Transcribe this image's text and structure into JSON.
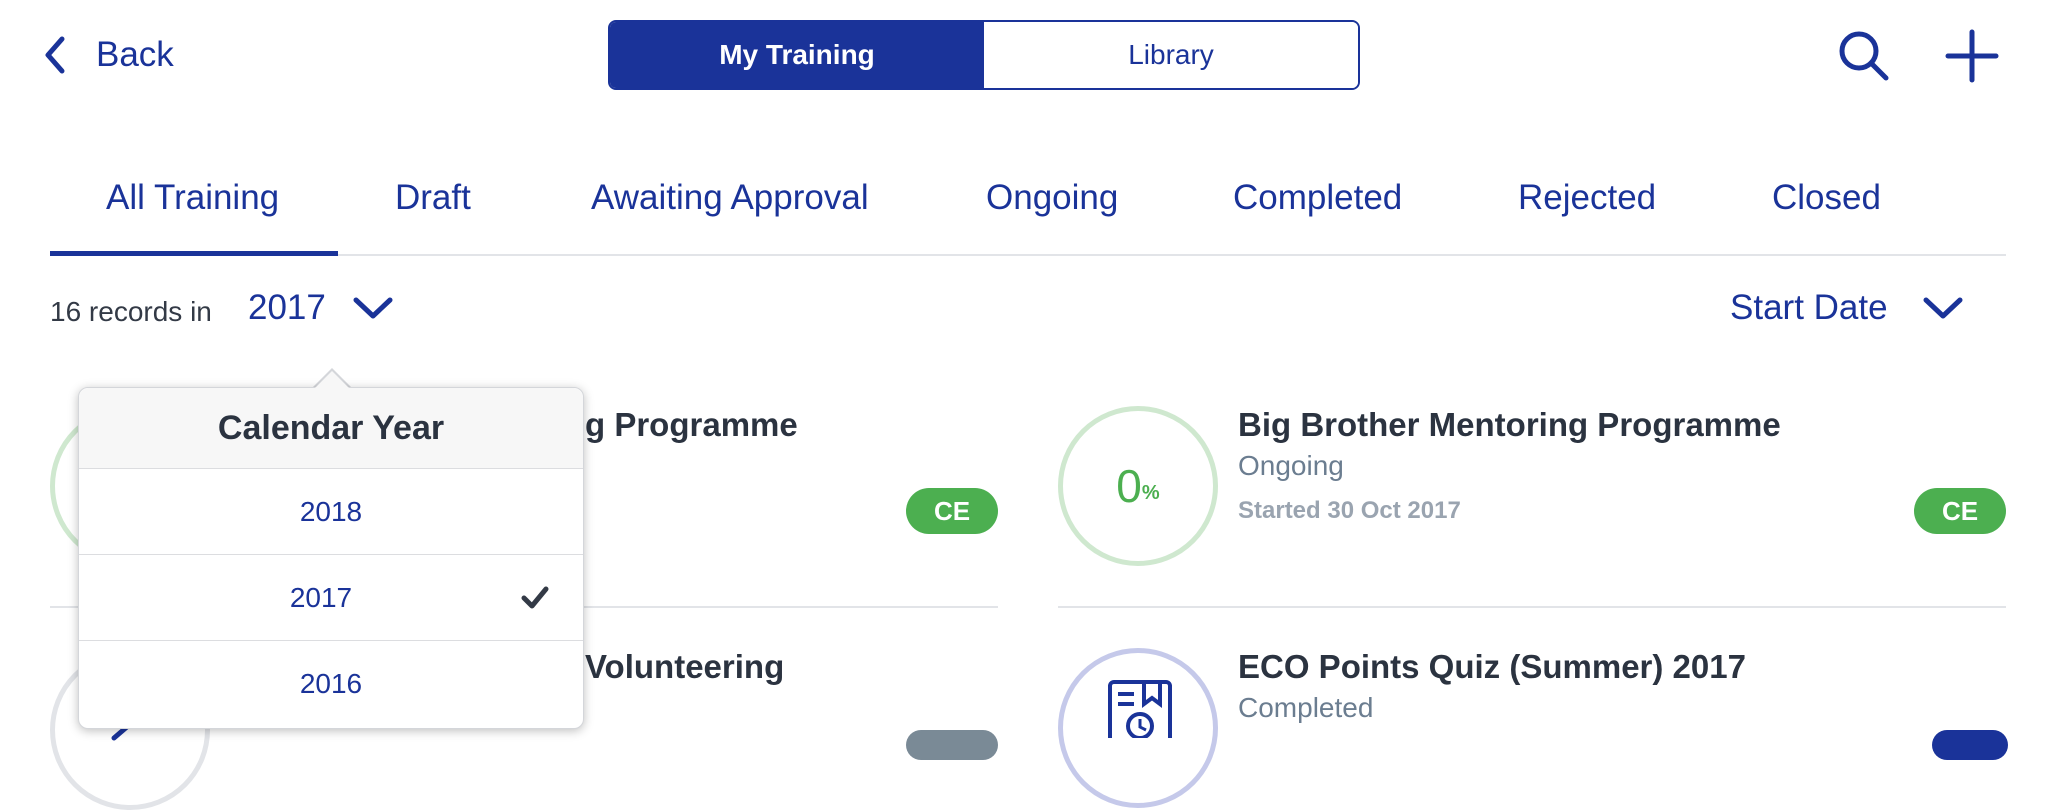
{
  "header": {
    "back_label": "Back",
    "segments": [
      {
        "label": "My Training",
        "active": true
      },
      {
        "label": "Library",
        "active": false
      }
    ],
    "icons": [
      "search-icon",
      "plus-icon"
    ]
  },
  "tabs": [
    {
      "label": "All Training",
      "active": true
    },
    {
      "label": "Draft"
    },
    {
      "label": "Awaiting Approval"
    },
    {
      "label": "Ongoing"
    },
    {
      "label": "Completed"
    },
    {
      "label": "Rejected"
    },
    {
      "label": "Closed"
    }
  ],
  "filter": {
    "records_text": "16 records in",
    "year": "2017",
    "sort_label": "Start Date"
  },
  "cards": [
    {
      "title_visible": "g Programme",
      "badge": "CE",
      "badge_color": "#4caf50"
    },
    {
      "title": "Big Brother Mentoring Programme",
      "status": "Ongoing",
      "date": "Started 30 Oct 2017",
      "progress_value": "0",
      "progress_unit": "%",
      "badge": "CE",
      "badge_color": "#4caf50"
    },
    {
      "title_visible": "Volunteering"
    },
    {
      "title": "ECO Points Quiz (Summer) 2017",
      "status": "Completed",
      "icon": "quiz-clock-icon"
    }
  ],
  "popover": {
    "title": "Calendar Year",
    "options": [
      {
        "label": "2018"
      },
      {
        "label": "2017",
        "selected": true
      },
      {
        "label": "2016"
      }
    ]
  },
  "colors": {
    "primary": "#1a3399",
    "green": "#4caf50",
    "ring_green": "#cfe8cf",
    "ring_blue": "#c5c9ea"
  }
}
